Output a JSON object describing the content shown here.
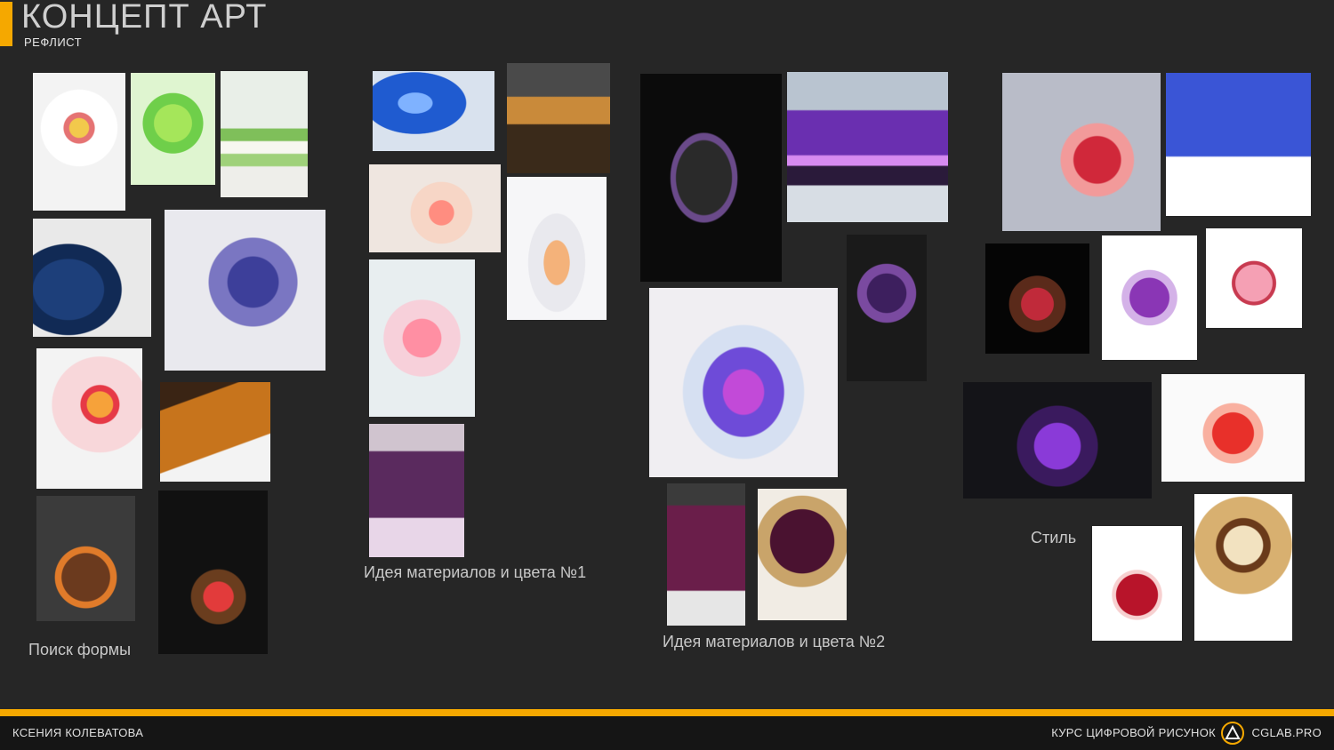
{
  "header": {
    "title": "КОНЦЕПТ АРТ",
    "subtitle": "РЕФЛИСТ",
    "accent_color": "#f5a800"
  },
  "groups": [
    {
      "label": "Поиск формы"
    },
    {
      "label": "Идея материалов и цвета №1"
    },
    {
      "label": "Идея материалов и цвета №2"
    },
    {
      "label": "Стиль"
    }
  ],
  "footer": {
    "author": "КСЕНИЯ КОЛЕВАТОВА",
    "course": "КУРС ЦИФРОВОЙ РИСУНОК",
    "logo_icon": "cglab-triangle-logo-icon",
    "site": "CGLAB.PRO"
  }
}
